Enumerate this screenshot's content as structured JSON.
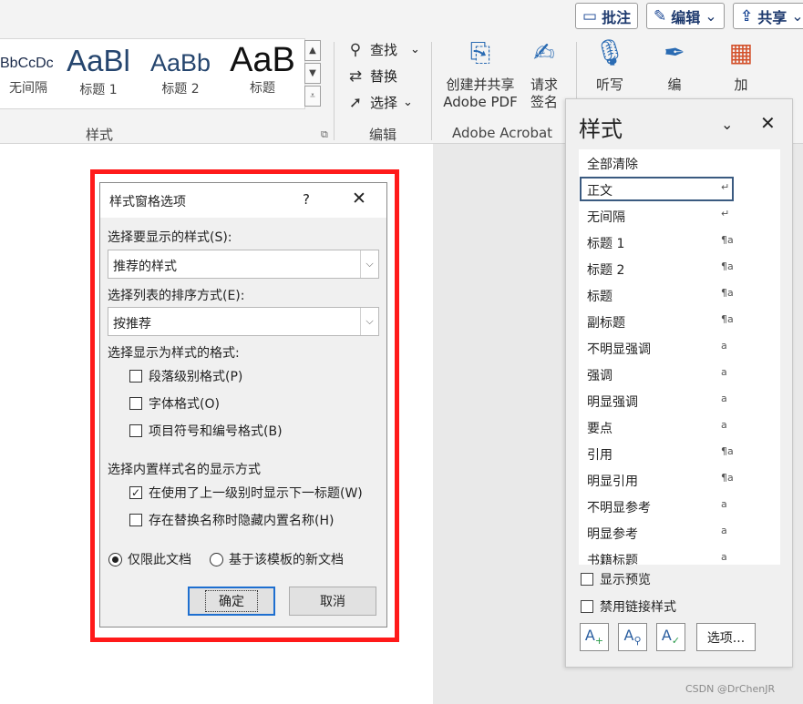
{
  "topbar": {
    "comment_label": "批注",
    "edit_label": "编辑",
    "edit_arrow": "⌄",
    "share_label": "共享",
    "share_arrow": "⌄"
  },
  "ribbon": {
    "gallery_items": [
      {
        "sample": "BbCcDc",
        "label": "无间隔"
      },
      {
        "sample": "AaBl",
        "label": "标题 1"
      },
      {
        "sample": "AaBb",
        "label": "标题 2"
      },
      {
        "sample": "AaB",
        "label": "标题"
      }
    ],
    "group_styles": "样式",
    "find_label": "查找",
    "find_arrow": "⌄",
    "replace_label": "替换",
    "select_label": "选择",
    "select_arrow": "⌄",
    "group_edit": "编辑",
    "create_pdf_line1": "创建并共享",
    "create_pdf_line2": "Adobe PDF",
    "request_sign_line1": "请求",
    "request_sign_line2": "签名",
    "group_acrobat": "Adobe Acrobat",
    "dictate_label": "听写",
    "editor_label": "编",
    "addin_label": "加"
  },
  "dialog": {
    "title": "样式窗格选项",
    "help": "?",
    "close": "✕",
    "show_label": "选择要显示的样式(S):",
    "show_value": "推荐的样式",
    "sort_label": "选择列表的排序方式(E):",
    "sort_value": "按推荐",
    "format_label": "选择显示为样式的格式:",
    "checks": [
      {
        "label": "段落级别格式(P)",
        "checked": ""
      },
      {
        "label": "字体格式(O)",
        "checked": ""
      },
      {
        "label": "项目符号和编号格式(B)",
        "checked": ""
      }
    ],
    "builtin_label": "选择内置样式名的显示方式",
    "builtin_checks": [
      {
        "label": "在使用了上一级别时显示下一标题(W)",
        "checked": "✓"
      },
      {
        "label": "存在替换名称时隐藏内置名称(H)",
        "checked": ""
      }
    ],
    "radio_doc": "仅限此文档",
    "radio_template": "基于该模板的新文档",
    "ok": "确定",
    "cancel": "取消"
  },
  "styles_pane": {
    "title": "样式",
    "chevron": "⌄",
    "close": "✕",
    "items": [
      {
        "name": "全部清除",
        "mark": ""
      },
      {
        "name": "正文",
        "mark": "↵"
      },
      {
        "name": "无间隔",
        "mark": "↵"
      },
      {
        "name": "标题 1",
        "mark": "¶a"
      },
      {
        "name": "标题 2",
        "mark": "¶a"
      },
      {
        "name": "标题",
        "mark": "¶a"
      },
      {
        "name": "副标题",
        "mark": "¶a"
      },
      {
        "name": "不明显强调",
        "mark": "a"
      },
      {
        "name": "强调",
        "mark": "a"
      },
      {
        "name": "明显强调",
        "mark": "a"
      },
      {
        "name": "要点",
        "mark": "a"
      },
      {
        "name": "引用",
        "mark": "¶a"
      },
      {
        "name": "明显引用",
        "mark": "¶a"
      },
      {
        "name": "不明显参考",
        "mark": "a"
      },
      {
        "name": "明显参考",
        "mark": "a"
      },
      {
        "name": "书籍标题",
        "mark": "a"
      }
    ],
    "show_preview": "显示预览",
    "disable_linked": "禁用链接样式",
    "options_button": "选项..."
  },
  "watermark": "CSDN @DrChenJR",
  "colors": {
    "highlight_frame": "#ff1a1a",
    "accent": "#1e6fd0"
  }
}
